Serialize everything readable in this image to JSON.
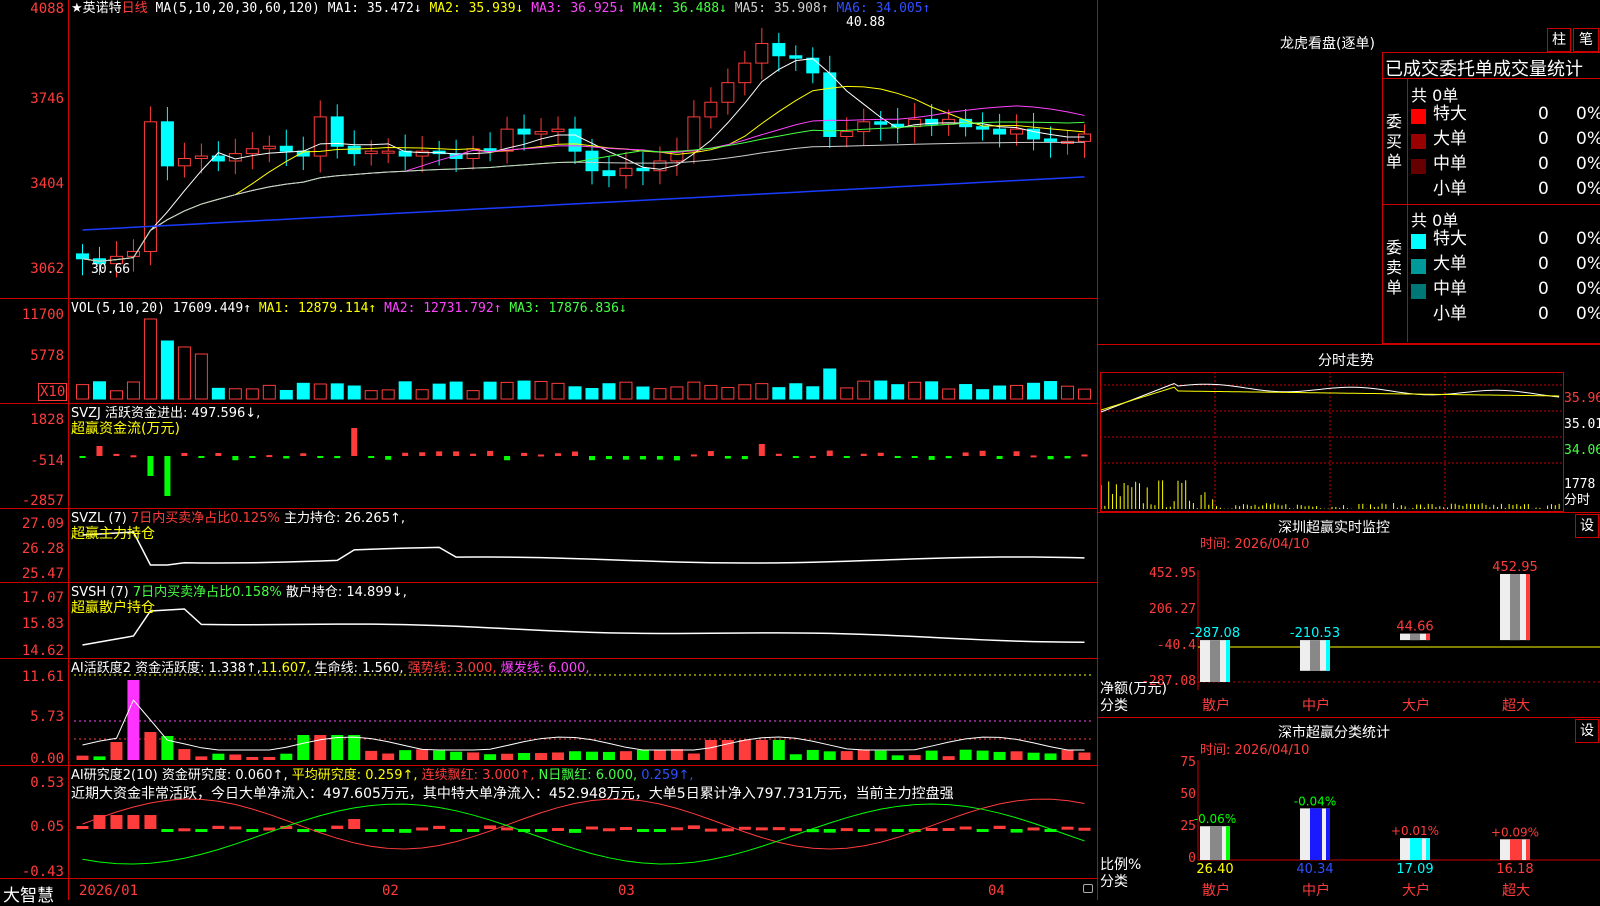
{
  "main": {
    "star": "★",
    "stock_name": "英诺特",
    "period": "日线",
    "ma_label": "MA(5,10,20,30,60,120)",
    "ma_values": [
      {
        "text": "MA1: 35.472↓",
        "color": "#ffffff"
      },
      {
        "text": "MA2: 35.939↓",
        "color": "#ffff00"
      },
      {
        "text": "MA3: 36.925↓",
        "color": "#ff44ff"
      },
      {
        "text": "MA4: 36.488↓",
        "color": "#44ff44"
      },
      {
        "text": "MA5: 35.908↑",
        "color": "#cfcfcf"
      },
      {
        "text": "MA6: 34.005↑",
        "color": "#3050ff"
      }
    ],
    "ticks": [
      "4088",
      "3746",
      "3404",
      "3062"
    ],
    "high_label": "40.88",
    "low_label": "30.66"
  },
  "vol": {
    "label": "VOL(5,10,20)",
    "values": [
      {
        "text": "17609.449↑",
        "color": "#ffffff"
      },
      {
        "text": "MA1: 12879.114↑",
        "color": "#ffff00"
      },
      {
        "text": "MA2: 12731.792↑",
        "color": "#ff44ff"
      },
      {
        "text": "MA3: 17876.836↓",
        "color": "#44ff44"
      }
    ],
    "ticks": [
      "11700",
      "5778"
    ],
    "unit": "X10"
  },
  "svzj": {
    "label": "SVZJ  活跃资金进出: 497.596↓,",
    "sub": "超赢资金流(万元)",
    "ticks": [
      "1828",
      "-514",
      "-2857"
    ]
  },
  "svzl": {
    "label": "SVZL (7)",
    "desc": "7日内买卖净占比0.125%",
    "hold": "主力持仓: 26.265↑,",
    "sub": "超赢主力持仓",
    "ticks": [
      "27.09",
      "26.28",
      "25.47"
    ]
  },
  "svsh": {
    "label": "SVSH (7)",
    "desc": "7日内买卖净占比0.158%",
    "hold": "散户持仓: 14.899↓,",
    "sub": "超赢散户持仓",
    "ticks": [
      "17.07",
      "15.83",
      "14.62"
    ]
  },
  "ai1": {
    "label": "AI活跃度2",
    "v1": "资金活跃度: 1.338↑,",
    "v2": "11.607,",
    "v3": "生命线: 1.560,",
    "v4": "强势线: 3.000,",
    "v5": "爆发线: 6.000,",
    "ticks": [
      "11.61",
      "5.73",
      "0.00"
    ]
  },
  "ai2": {
    "label": "AI研究度2(10)",
    "v1": "资金研究度: 0.060↑,",
    "v2": "平均研究度: 0.259↑,",
    "v3": "连续飘红: 3.000↑,",
    "v4": "N日飘红: 6.000,",
    "v5": "0.259↑,",
    "comment": "近期大资金非常活跃，今日大单净流入：497.605万元，其中特大单净流入：452.948万元，大单5日累计净入797.731万元，当前主力控盘强",
    "ticks": [
      "0.53",
      "0.05",
      "-0.43"
    ]
  },
  "xaxis": {
    "labels": [
      "2026/01",
      "02",
      "03",
      "04"
    ],
    "brand": "大智慧"
  },
  "right": {
    "lhkp_title": "龙虎看盘(逐单)",
    "btn_zhu": "柱",
    "btn_bi": "笔",
    "stat_title": "已成交委托单成交量统计",
    "buy_label": "委买单",
    "sell_label": "委卖单",
    "buy_total": "共 0单",
    "sell_total": "共 0单",
    "buy_rows": [
      {
        "name": "特大",
        "count": "0",
        "pct": "0%",
        "color": "#ff0000"
      },
      {
        "name": "大单",
        "count": "0",
        "pct": "0%",
        "color": "#990000"
      },
      {
        "name": "中单",
        "count": "0",
        "pct": "0%",
        "color": "#660000"
      },
      {
        "name": "小单",
        "count": "0",
        "pct": "0%",
        "color": ""
      }
    ],
    "sell_rows": [
      {
        "name": "特大",
        "count": "0",
        "pct": "0%",
        "color": "#00ffff"
      },
      {
        "name": "大单",
        "count": "0",
        "pct": "0%",
        "color": "#009999"
      },
      {
        "name": "中单",
        "count": "0",
        "pct": "0%",
        "color": "#007777"
      },
      {
        "name": "小单",
        "count": "0",
        "pct": "0%",
        "color": ""
      }
    ],
    "fs_title": "分时走势",
    "fs_ticks": [
      "35.96",
      "35.01",
      "34.06"
    ],
    "fs_vol_tick": "1778",
    "fs_vol_unit": "分时",
    "sz_title": "深圳超赢实时监控",
    "sz_btn": "设",
    "sz_time": "时间: 2026/04/10",
    "sz_ticks": [
      "452.95",
      "206.27",
      "-40.4",
      "-287.08"
    ],
    "sz_ylabel": "净额(万元)",
    "sz_xlabel": "分类",
    "sz_cats": [
      "散户",
      "中户",
      "大户",
      "超大"
    ],
    "sz_values": [
      "-287.08",
      "-210.53",
      "44.66",
      "452.95"
    ],
    "ss_title": "深市超赢分类统计",
    "ss_btn": "设",
    "ss_time": "时间: 2026/04/10",
    "ss_ticks": [
      "75",
      "50",
      "25",
      "0"
    ],
    "ss_ylabel": "比例%",
    "ss_xlabel": "分类",
    "ss_cats": [
      "散户",
      "中户",
      "大户",
      "超大"
    ],
    "ss_values": [
      "26.40",
      "40.34",
      "17.09",
      "16.18"
    ],
    "ss_changes": [
      "-0.06%",
      "-0.04%",
      "+0.01%",
      "+0.09%"
    ]
  }
}
